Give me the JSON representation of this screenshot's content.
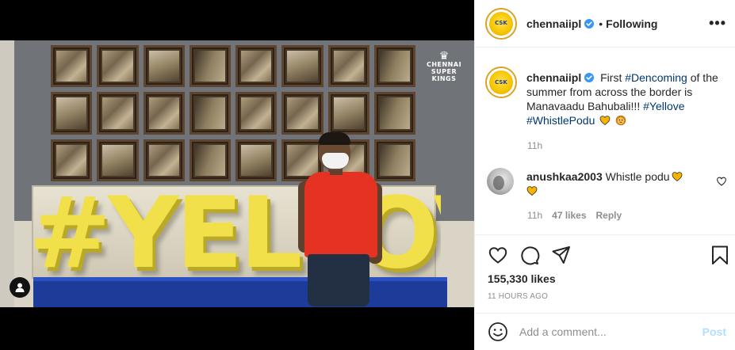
{
  "post": {
    "media": {
      "sign_text": "#YELLOVE",
      "watermark_line1": "CHENNAI",
      "watermark_line2": "SUPER",
      "watermark_line3": "KINGS"
    },
    "header": {
      "username": "chennaiipl",
      "separator": "•",
      "follow_status": "Following",
      "more_label": "•••"
    },
    "caption": {
      "username": "chennaiipl",
      "text_before": " First ",
      "hashtag1": "#Dencoming",
      "text_middle": " of the summer from across the border is Manavaadu Bahubali!!! ",
      "hashtag2": "#Yellove",
      "hashtag3": "#WhistlePodu",
      "emojis": [
        "yellow-heart",
        "lion-face"
      ],
      "time": "11h"
    },
    "comments": [
      {
        "username": "anushkaa2003",
        "text": "Whistle podu",
        "emojis": [
          "yellow-heart",
          "yellow-heart"
        ],
        "time": "11h",
        "likes": "47 likes",
        "reply_label": "Reply"
      }
    ],
    "actions": {
      "icons": [
        "heart-icon",
        "comment-icon",
        "share-icon",
        "bookmark-icon"
      ]
    },
    "likes": "155,330 likes",
    "posted_ago": "11 HOURS AGO",
    "add_comment": {
      "placeholder": "Add a comment...",
      "post_label": "Post"
    },
    "colors": {
      "link": "#00376b",
      "verified": "#3897f0",
      "post_disabled": "#b2dffc",
      "emoji_yellow": "#f4b400"
    },
    "avatar_text": "CSK"
  }
}
